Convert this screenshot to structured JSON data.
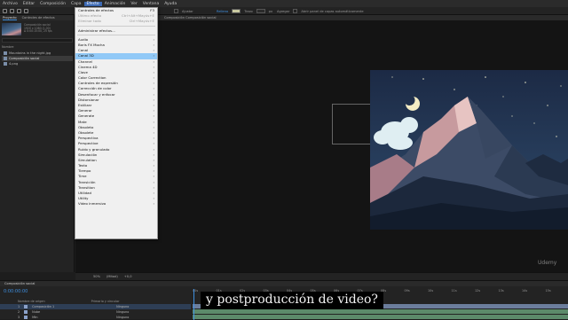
{
  "menubar": {
    "items": [
      "Archivo",
      "Editar",
      "Composición",
      "Capa",
      "Efecto",
      "Animación",
      "Ver",
      "Ventana",
      "Ayuda"
    ],
    "active_index": 4
  },
  "toolbar": {
    "align_label": "Ajustar",
    "fill_label": "Relleno",
    "stroke_label": "Trazo",
    "stroke_value": "px",
    "add_label": "Agregar",
    "auto_open_label": "Abrir panel de capas automáticamente",
    "fill_color": "#c9c9a0"
  },
  "project": {
    "tab_project": "Proyecto",
    "tab_effects": "Controles de efectos",
    "thumb_info": "Composición social\n1920 x 1080 (1,00)\nΔ 0:00:15:00, 25 fps",
    "name_col": "Nombre",
    "files": [
      {
        "name": "Mountains in the night.jpg",
        "selected": false
      },
      {
        "name": "Composición social",
        "selected": true
      },
      {
        "name": "4.png",
        "selected": false
      }
    ]
  },
  "viewer": {
    "tab_label": "Composición  Composición social",
    "footer": [
      "50%",
      "(Mitad)",
      "+0,0"
    ]
  },
  "effect_menu": {
    "top_items": [
      {
        "label": "Controles de efectos",
        "shortcut": "F3",
        "disabled": false
      },
      {
        "label": "Último efecto",
        "shortcut": "Ctrl+Alt+Mayús+E",
        "disabled": true
      },
      {
        "label": "Eliminar todo",
        "shortcut": "Ctrl+Mayús+E",
        "disabled": true
      }
    ],
    "manager": "Administrar efectos...",
    "categories": [
      "Audio",
      "Boris FX Mocha",
      "Canal",
      "Canal 3D",
      "Channel",
      "Cinema 4D",
      "Clave",
      "Color Correction",
      "Controles de expresión",
      "Corrección de color",
      "Desenfocar y enfocar",
      "Distorsionar",
      "Estilizar",
      "Generar",
      "Generate",
      "Mate",
      "Obsoleto",
      "Obsolete",
      "Perspectiva",
      "Perspective",
      "Ruido y granulado",
      "Simulación",
      "Simulation",
      "Texto",
      "Tiempo",
      "Time",
      "Transición",
      "Transition",
      "Utilidad",
      "Utility",
      "Video inmersivo"
    ],
    "highlighted_index": 3
  },
  "timeline": {
    "tab_label": "Composición social",
    "timecode": "0:00:00:00",
    "header_source": "Nombre de origen",
    "header_parent": "Primario y vincular",
    "layers": [
      {
        "num": "1",
        "name": "Composición 1",
        "parent": "Ninguno",
        "color": "#8aa0c8",
        "selected": true
      },
      {
        "num": "2",
        "name": "Nube",
        "parent": "Ninguno",
        "color": "#8aa0c8",
        "selected": false
      },
      {
        "num": "3",
        "name": "Mtn",
        "parent": "Ninguno",
        "color": "#8aa0c8",
        "selected": false
      }
    ],
    "ruler_ticks": [
      "00s",
      "01s",
      "02s",
      "03s",
      "04s",
      "05s",
      "06s",
      "07s",
      "08s",
      "09s",
      "10s",
      "11s",
      "12s",
      "13s",
      "14s",
      "15s"
    ]
  },
  "overlay": {
    "subtitle": "y postproducción de video?",
    "watermark": "Udemy"
  }
}
